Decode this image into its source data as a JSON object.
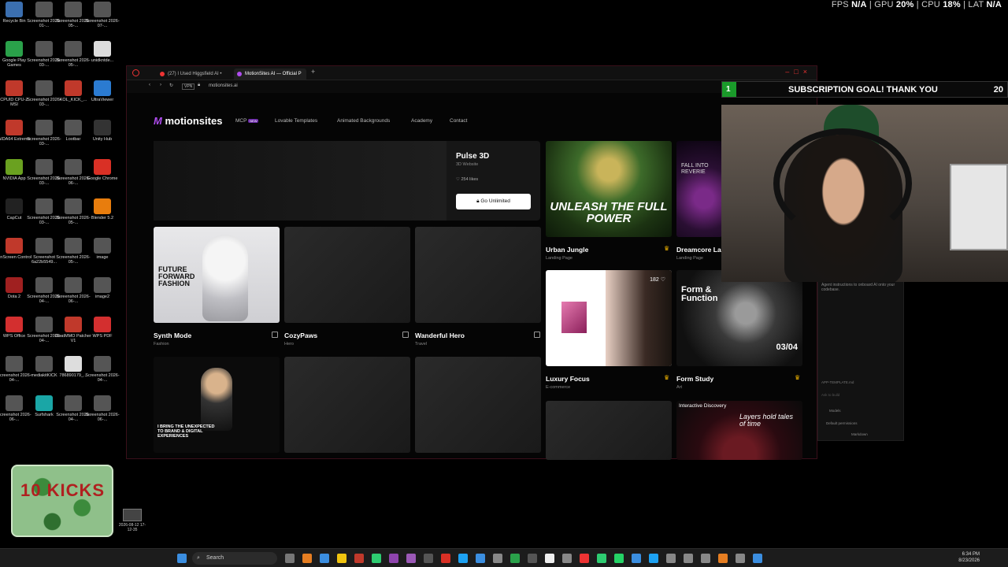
{
  "hud": {
    "fps_label": "FPS",
    "fps": "N/A",
    "gpu_label": "GPU",
    "gpu": "20%",
    "cpu_label": "CPU",
    "cpu": "18%",
    "lat_label": "LAT",
    "lat": "N/A"
  },
  "desktop": {
    "icons": [
      {
        "label": "Recycle Bin",
        "color": "#3b6fb0"
      },
      {
        "label": "Screenshot 2026-01-...",
        "color": "#555"
      },
      {
        "label": "Screenshot 2026-05-...",
        "color": "#555"
      },
      {
        "label": "Screenshot 2026-07-...",
        "color": "#555"
      },
      {
        "label": "Google Play Games",
        "color": "#2aa14a"
      },
      {
        "label": "Screenshot 2026-03-...",
        "color": "#555"
      },
      {
        "label": "Screenshot 2026-05-...",
        "color": "#555"
      },
      {
        "label": "unidkntde...",
        "color": "#ddd"
      },
      {
        "label": "CPUID CPU-Z MSI",
        "color": "#c0392b"
      },
      {
        "label": "Screenshot 2026-03-...",
        "color": "#555"
      },
      {
        "label": "KOL_KICK_...",
        "color": "#c0392b"
      },
      {
        "label": "UltraViewer",
        "color": "#2b7bd1"
      },
      {
        "label": "AIDA64 Extreme",
        "color": "#c0392b"
      },
      {
        "label": "Screenshot 2026-03-...",
        "color": "#555"
      },
      {
        "label": "Lootbar",
        "color": "#555"
      },
      {
        "label": "Unity Hub",
        "color": "#333"
      },
      {
        "label": "NVIDIA App",
        "color": "#6aa120"
      },
      {
        "label": "Screenshot 2026-03-...",
        "color": "#555"
      },
      {
        "label": "Screenshot 2026-06-...",
        "color": "#555"
      },
      {
        "label": "Google Chrome",
        "color": "#d93025"
      },
      {
        "label": "CapCut",
        "color": "#222"
      },
      {
        "label": "Screenshot 2026-03-...",
        "color": "#555"
      },
      {
        "label": "Screenshot 2026-05-...",
        "color": "#555"
      },
      {
        "label": "Blender 5.2",
        "color": "#e87d0d"
      },
      {
        "label": "OnScreen Control",
        "color": "#c0392b"
      },
      {
        "label": "Screenshot 6a22b5549...",
        "color": "#555"
      },
      {
        "label": "Screenshot 2026-05-...",
        "color": "#555"
      },
      {
        "label": "image",
        "color": "#555"
      },
      {
        "label": "Dota 2",
        "color": "#a02020"
      },
      {
        "label": "Screenshot 2026-04-...",
        "color": "#555"
      },
      {
        "label": "Screenshot 2026-06-...",
        "color": "#555"
      },
      {
        "label": "image2",
        "color": "#555"
      },
      {
        "label": "WPS Office",
        "color": "#d32f2f"
      },
      {
        "label": "Screenshot 2026-04-...",
        "color": "#555"
      },
      {
        "label": "GoatMMO Patcher V1",
        "color": "#c0392b"
      },
      {
        "label": "WPS PDF",
        "color": "#d32f2f"
      },
      {
        "label": "Screenshot 2026-04-...",
        "color": "#555"
      },
      {
        "label": "mediakitKICK",
        "color": "#555"
      },
      {
        "label": "786890179_...",
        "color": "#ddd"
      },
      {
        "label": "Screenshot 2026-04-...",
        "color": "#555"
      },
      {
        "label": "Screenshot 2026-06-...",
        "color": "#555"
      },
      {
        "label": "Surfshark",
        "color": "#1aa6a6"
      },
      {
        "label": "Screenshot 2026-04-...",
        "color": "#555"
      },
      {
        "label": "Screenshot 2026-06-...",
        "color": "#555"
      }
    ],
    "kicks_text": "10 KICKS",
    "folder_label": "2026-08-12 17-12-35"
  },
  "browser": {
    "tabs": [
      {
        "label": "(27) I Used Higgsfield AI •",
        "color": "#e33"
      },
      {
        "label": "MotionSites AI — Official P",
        "color": "#b04df0"
      }
    ],
    "url": "motionsites.ai",
    "vpn": "VPN"
  },
  "site": {
    "logo": "motionsites",
    "nav": [
      "MCP",
      "Lovable Templates",
      "Animated Backgrounds",
      "Academy",
      "Contact"
    ],
    "mcp_badge": "NEW",
    "featured": {
      "title": "Pulse 3D",
      "subtitle": "3D Website",
      "likes": "254 likes",
      "cta": "Go Unlimited"
    },
    "cards": [
      {
        "title": "Synth Mode",
        "sub": "Fashion",
        "thumb_text": "FUTURE FORWARD FASHION"
      },
      {
        "title": "CozyPaws",
        "sub": "Hero"
      },
      {
        "title": "Wanderful Hero",
        "sub": "Travel"
      },
      {
        "title": "Urban Jungle",
        "sub": "Landing Page",
        "thumb_text": "UNLEASH THE FULL POWER"
      },
      {
        "title": "Dreamcore La",
        "sub": "Landing Page",
        "thumb_text": "FALL INTO REVERIE"
      },
      {
        "title": "Luxury Focus",
        "sub": "E-commerce",
        "likes": "182"
      },
      {
        "title": "Form Study",
        "sub": "Art",
        "thumb_text": "Form & Function",
        "counter": "03/04"
      },
      {
        "thumb_text": "I BRING THE UNEXPECTED TO BRAND & DIGITAL EXPERIENCES"
      },
      {
        "thumb_text": "Layers hold tales of time",
        "badge": "Interactive Discovery"
      }
    ],
    "side_panel": {
      "text": "Agent instructions to onboard AI onto your codebase.",
      "file": "APP-TEMPLATE.md",
      "placeholder": "Ask to build",
      "models": "Models",
      "perm": "Default permissions",
      "markdown": "Markdown"
    }
  },
  "overlay": {
    "goal_count": "1",
    "goal_text": "SUBSCRIPTION GOAL! THANK YOU",
    "goal_target": "20",
    "goal_progress": 0.05
  },
  "taskbar": {
    "search": "Search",
    "time": "6:34 PM",
    "date": "8/23/2026"
  }
}
